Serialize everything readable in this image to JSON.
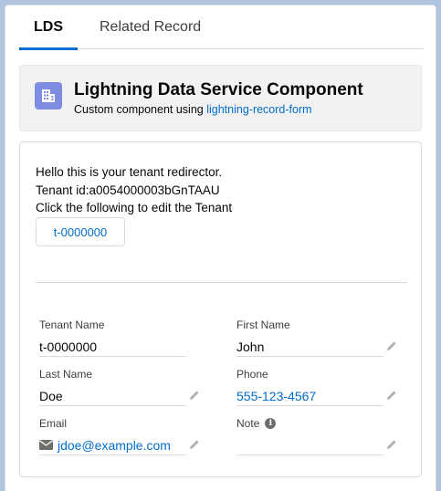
{
  "tabs": [
    {
      "label": "LDS",
      "active": true
    },
    {
      "label": "Related Record",
      "active": false
    }
  ],
  "header": {
    "title": "Lightning Data Service Component",
    "subtitle_prefix": "Custom component using ",
    "subtitle_link": "lightning-record-form",
    "icon": "building-icon"
  },
  "redirector": {
    "line1": "Hello this is your tenant redirector.",
    "line2": "Tenant id:a0054000003bGnTAAU",
    "line3": "Click the following to edit the Tenant",
    "button_label": "t-0000000"
  },
  "fields": {
    "tenant_name": {
      "label": "Tenant Name",
      "value": "t-0000000"
    },
    "first_name": {
      "label": "First Name",
      "value": "John"
    },
    "last_name": {
      "label": "Last Name",
      "value": "Doe"
    },
    "phone": {
      "label": "Phone",
      "value": "555-123-4567"
    },
    "email": {
      "label": "Email",
      "value": "jdoe@example.com"
    },
    "note": {
      "label": "Note",
      "value": ""
    }
  },
  "colors": {
    "accent": "#0070d2",
    "link": "#006dcc",
    "icon_bg": "#7f8de1"
  }
}
